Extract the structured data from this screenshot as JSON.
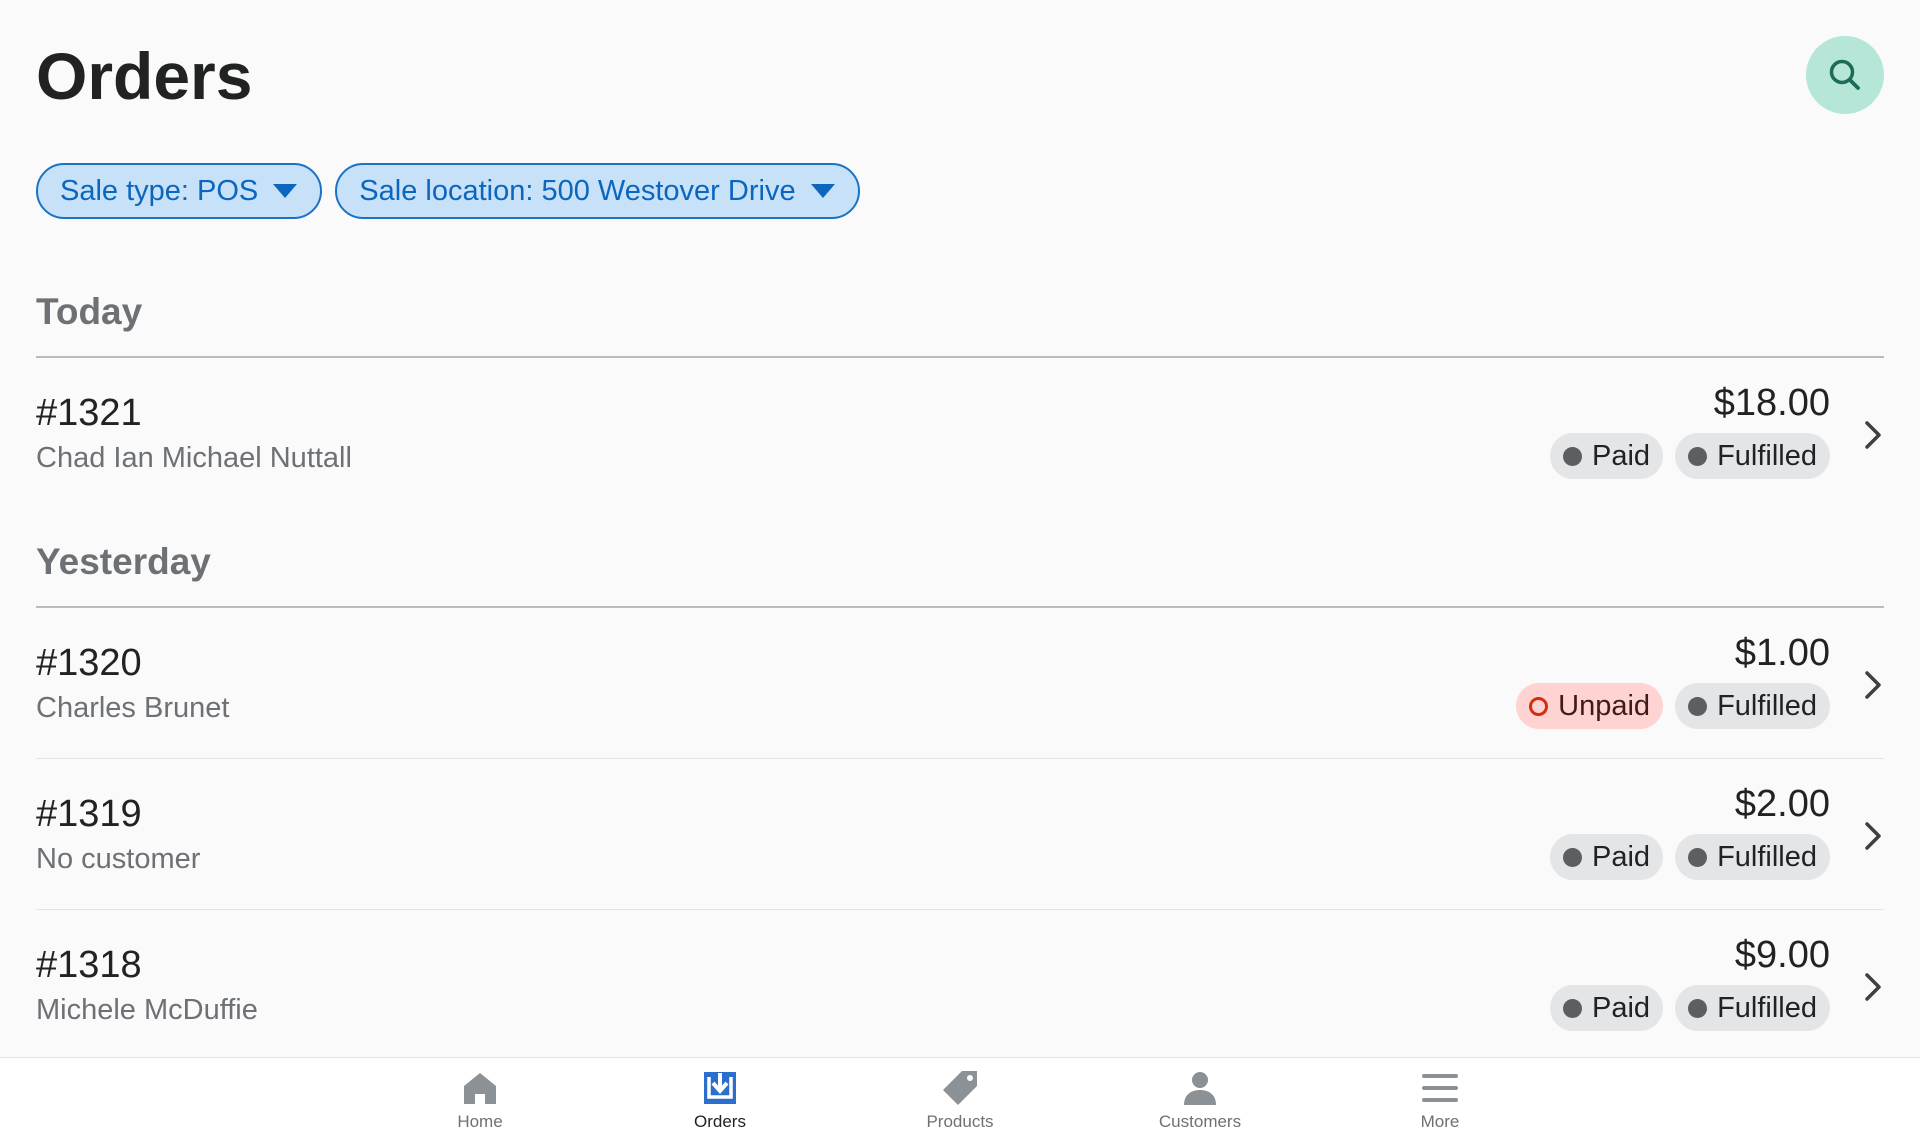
{
  "header": {
    "title": "Orders",
    "search_icon": "search-icon"
  },
  "filters": [
    {
      "label": "Sale type: POS"
    },
    {
      "label": "Sale location: 500 Westover Drive"
    }
  ],
  "sections": [
    {
      "title": "Today",
      "orders": [
        {
          "number": "#1321",
          "customer": "Chad Ian Michael Nuttall",
          "total": "$18.00",
          "payment": "Paid",
          "fulfillment": "Fulfilled"
        }
      ]
    },
    {
      "title": "Yesterday",
      "orders": [
        {
          "number": "#1320",
          "customer": "Charles Brunet",
          "total": "$1.00",
          "payment": "Unpaid",
          "fulfillment": "Fulfilled"
        },
        {
          "number": "#1319",
          "customer": "No customer",
          "total": "$2.00",
          "payment": "Paid",
          "fulfillment": "Fulfilled"
        },
        {
          "number": "#1318",
          "customer": "Michele McDuffie",
          "total": "$9.00",
          "payment": "Paid",
          "fulfillment": "Fulfilled"
        }
      ]
    }
  ],
  "nav": [
    {
      "label": "Home",
      "icon": "home-icon"
    },
    {
      "label": "Orders",
      "icon": "orders-icon",
      "active": true
    },
    {
      "label": "Products",
      "icon": "tag-icon"
    },
    {
      "label": "Customers",
      "icon": "person-icon"
    },
    {
      "label": "More",
      "icon": "menu-icon"
    }
  ],
  "colors": {
    "accent": "#1b72c6",
    "search_bg": "#b5e6d8",
    "unpaid_bg": "#fed3d1",
    "nav_active": "#2c6ecb"
  }
}
